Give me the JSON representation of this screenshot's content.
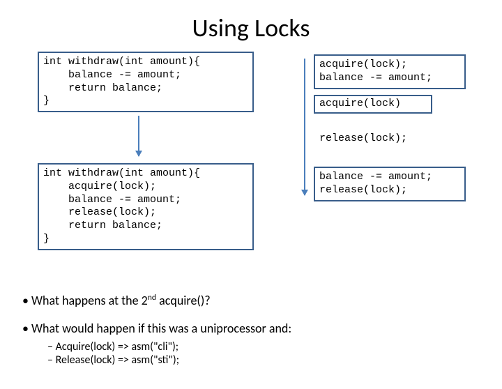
{
  "title": "Using Locks",
  "code": {
    "withdraw1": "int withdraw(int amount){\n    balance -= amount;\n    return balance;\n}",
    "withdraw2": "int withdraw(int amount){\n    acquire(lock);\n    balance -= amount;\n    release(lock);\n    return balance;\n}",
    "right1": "acquire(lock);\nbalance -= amount;",
    "right2": "acquire(lock)",
    "right3": "release(lock);",
    "right4": "balance -= amount;\nrelease(lock);"
  },
  "bullets": {
    "b1_pre": "What happens at the 2",
    "b1_sup": "nd",
    "b1_post": " acquire()?",
    "b2": "What would happen if this was a uniprocessor and:",
    "s1": "Acquire(lock) => asm(\"cli\");",
    "s2": "Release(lock) => asm(\"sti\");"
  }
}
